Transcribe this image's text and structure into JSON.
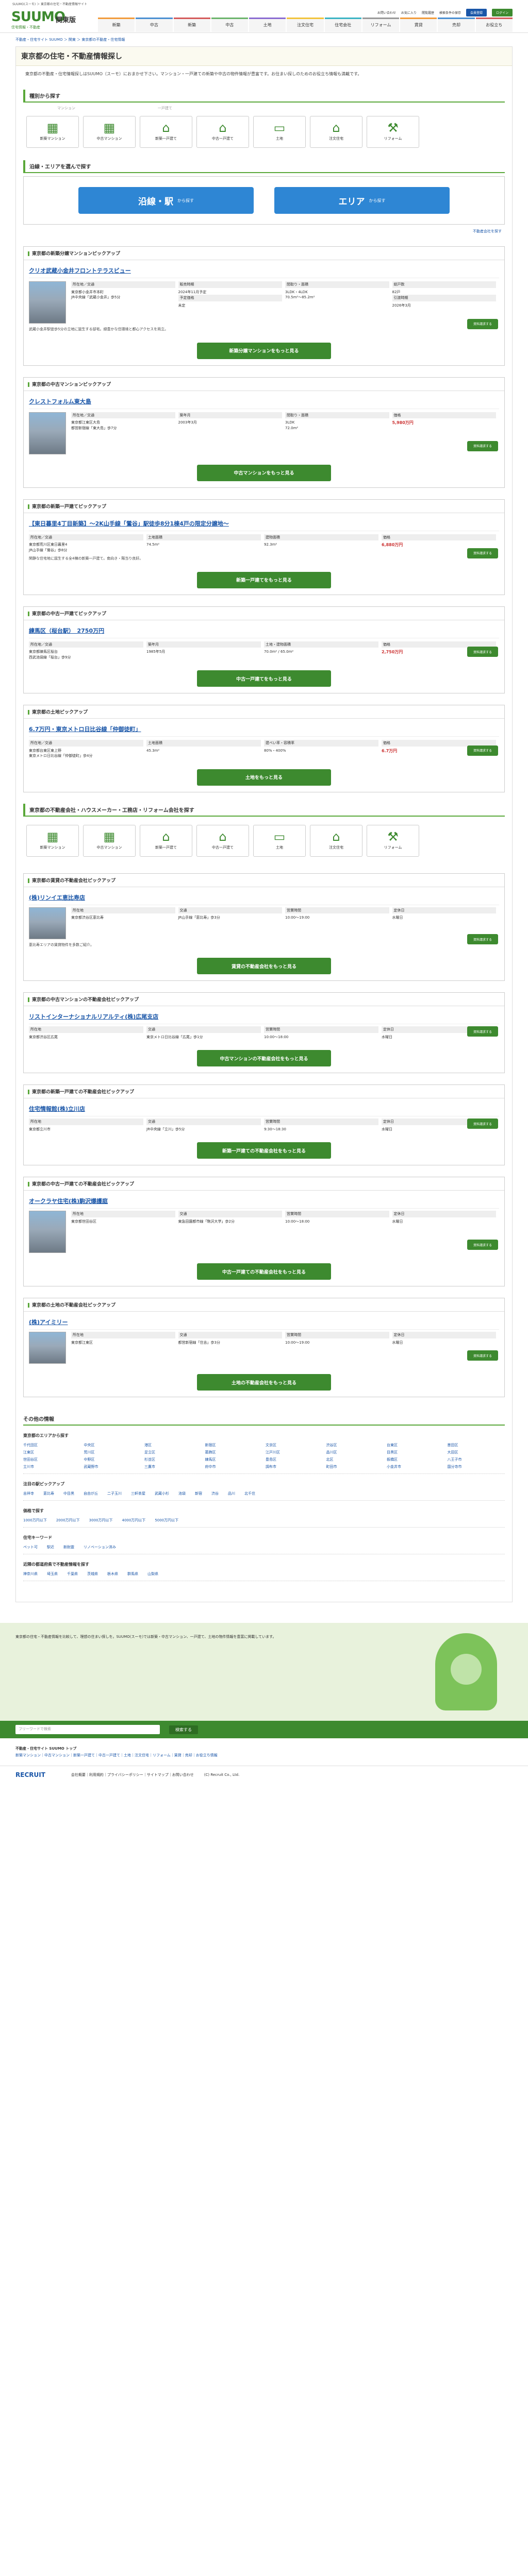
{
  "top": {
    "strip": "SUUMO(スーモ) ＞ 東京都の住宅・不動産情報サイト"
  },
  "header": {
    "logo": "SUUMO",
    "logo_sub": "住宅情報・不動産",
    "region": "関東版",
    "util": [
      "お問い合わせ",
      "お気に入り",
      "閲覧履歴",
      "検索条件の保存",
      "ログイン"
    ],
    "register": "会員登録",
    "login": "ログイン",
    "minilist": [
      "新築マンション",
      "中古マンション",
      "新築一戸建て",
      "中古一戸建て",
      "土地",
      "賃貸",
      "リフォーム"
    ],
    "cats": [
      "新築",
      "中古",
      "新築",
      "中古",
      "土地",
      "注文住宅",
      "住宅会社",
      "リフォーム",
      "賃貸",
      "売却",
      "お役立ち"
    ]
  },
  "breadcrumb": "不動産・住宅サイト SUUMO ＞ 関東 ＞ 東京都の不動産・住宅情報",
  "title": "東京都の住宅・不動産情報探し",
  "intro": "東京都の不動産・住宅情報探しはSUUMO（スーモ）におまかせ下さい。マンション・一戸建ての新築や中古の物件情報が豊富です。お住まい探しのためのお役立ち情報も満載です。",
  "types_heading": "種別から探す",
  "types_sub_left": "マンション",
  "types_sub_right": "一戸建て",
  "types": [
    {
      "icon": "building",
      "label": "新築マンション"
    },
    {
      "icon": "building",
      "label": "中古マンション"
    },
    {
      "icon": "house",
      "label": "新築一戸建て"
    },
    {
      "icon": "house",
      "label": "中古一戸建て"
    },
    {
      "icon": "land",
      "label": "土地"
    },
    {
      "icon": "plan",
      "label": "注文住宅"
    },
    {
      "icon": "tools",
      "label": "リフォーム"
    }
  ],
  "area_heading": "沿線・エリアを選んで探す",
  "search_btns": [
    {
      "label": "沿線・駅",
      "sub": "から探す"
    },
    {
      "label": "エリア",
      "sub": "から探す"
    }
  ],
  "help_link": "不動産会社を探す",
  "pickups": [
    {
      "heading": "東京都の新築分譲マンションピックアップ",
      "title": "クリオ武蔵小金井フロントテラスビュー",
      "cols": [
        [
          "所在地／交通",
          "東京都小金井市本町",
          "JR中央線「武蔵小金井」歩5分"
        ],
        [
          "販売時期",
          "2024年11月予定",
          "予定価格",
          "未定"
        ],
        [
          "間取り・面積",
          "3LDK・4LDK",
          "70.5m²～85.2m²"
        ],
        [
          "総戸数",
          "82戸",
          "引渡時期",
          "2026年3月"
        ]
      ],
      "desc": "武蔵小金井駅徒歩5分の立地に誕生する邸宅。緑豊かな住環境と都心アクセスを両立。",
      "more": "新築分譲マンションをもっと見る",
      "img": "tall"
    },
    {
      "heading": "東京都の中古マンションピックアップ",
      "title": "クレストフォルム東大島",
      "cols": [
        [
          "所在地／交通",
          "東京都江東区大島",
          "都営新宿線「東大島」歩7分"
        ],
        [
          "築年月",
          "2003年3月"
        ],
        [
          "間取り・面積",
          "3LDK",
          "72.0m²"
        ],
        [
          "価格",
          "5,980万円"
        ]
      ],
      "desc": "",
      "more": "中古マンションをもっと見る",
      "img": "tall"
    },
    {
      "heading": "東京都の新築一戸建てピックアップ",
      "title": "【東日暮里4丁目新築】～2K山手線「鶯谷」駅徒歩8分1棟4戸の限定分譲地～",
      "cols": [
        [
          "所在地／交通",
          "東京都荒川区東日暮里4",
          "JR山手線「鶯谷」歩8分"
        ],
        [
          "土地面積",
          "74.5m²"
        ],
        [
          "建物面積",
          "92.3m²"
        ],
        [
          "価格",
          "6,880万円"
        ]
      ],
      "desc": "閑静な住宅地に誕生する全4棟の新築一戸建て。南向き・陽当り良好。",
      "more": "新築一戸建てをもっと見る",
      "img": "none"
    },
    {
      "heading": "東京都の中古一戸建てピックアップ",
      "title": "練馬区（桜台駅）　2750万円",
      "cols": [
        [
          "所在地／交通",
          "東京都練馬区桜台",
          "西武池袋線「桜台」歩9分"
        ],
        [
          "築年月",
          "1985年5月"
        ],
        [
          "土地・建物面積",
          "70.0m² / 65.0m²"
        ],
        [
          "価格",
          "2,750万円"
        ]
      ],
      "desc": "",
      "more": "中古一戸建てをもっと見る",
      "img": "none"
    },
    {
      "heading": "東京都の土地ピックアップ",
      "title": "6.7万円・東京メトロ日比谷線「仲御徒町」",
      "cols": [
        [
          "所在地／交通",
          "東京都台東区東上野",
          "東京メトロ日比谷線「仲御徒町」歩4分"
        ],
        [
          "土地面積",
          "45.3m²"
        ],
        [
          "建ぺい率・容積率",
          "80%・400%"
        ],
        [
          "価格",
          "6.7万円"
        ]
      ],
      "desc": "",
      "more": "土地をもっと見る",
      "img": "none"
    }
  ],
  "agent_heading": "東京都の不動産会社・ハウスメーカー・工務店・リフォーム会社を探す",
  "agent_types": [
    "新築マンション",
    "中古マンション",
    "新築一戸建て",
    "中古一戸建て",
    "土地",
    "注文住宅",
    "リフォーム"
  ],
  "agents": [
    {
      "heading": "東京都の賃貸の不動産会社ピックアップ",
      "title": "(株)リンイエ恵比寿店",
      "cols": [
        [
          "所在地",
          "東京都渋谷区恵比寿"
        ],
        [
          "交通",
          "JR山手線「恵比寿」歩3分"
        ],
        [
          "営業時間",
          "10:00～19:00"
        ],
        [
          "定休日",
          "水曜日"
        ]
      ],
      "desc": "恵比寿エリアの賃貸物件を多数ご紹介。",
      "more": "賃貸の不動産会社をもっと見る"
    },
    {
      "heading": "東京都の中古マンションの不動産会社ピックアップ",
      "title": "リストインターナショナルリアルティ(株)広尾支店",
      "cols": [
        [
          "所在地",
          "東京都渋谷区広尾"
        ],
        [
          "交通",
          "東京メトロ日比谷線「広尾」歩1分"
        ],
        [
          "営業時間",
          "10:00～18:00"
        ],
        [
          "定休日",
          "水曜日"
        ]
      ],
      "desc": "",
      "more": "中古マンションの不動産会社をもっと見る"
    },
    {
      "heading": "東京都の新築一戸建ての不動産会社ピックアップ",
      "title": "住宅情報館(株)立川店",
      "cols": [
        [
          "所在地",
          "東京都立川市"
        ],
        [
          "交通",
          "JR中央線「立川」歩5分"
        ],
        [
          "営業時間",
          "9:30～18:30"
        ],
        [
          "定休日",
          "水曜日"
        ]
      ],
      "desc": "",
      "more": "新築一戸建ての不動産会社をもっと見る"
    },
    {
      "heading": "東京都の中古一戸建ての不動産会社ピックアップ",
      "title": "オークラヤ住宅(株)駒沢爆護庭",
      "cols": [
        [
          "所在地",
          "東京都世田谷区"
        ],
        [
          "交通",
          "東急田園都市線「駒沢大学」歩2分"
        ],
        [
          "営業時間",
          "10:00～18:00"
        ],
        [
          "定休日",
          "水曜日"
        ]
      ],
      "desc": "",
      "more": "中古一戸建ての不動産会社をもっと見る"
    },
    {
      "heading": "東京都の土地の不動産会社ピックアップ",
      "title": "(株)アイミリー",
      "cols": [
        [
          "所在地",
          "東京都江東区"
        ],
        [
          "交通",
          "都営新宿線「住吉」歩3分"
        ],
        [
          "営業時間",
          "10:00～19:00"
        ],
        [
          "定休日",
          "水曜日"
        ]
      ],
      "desc": "",
      "more": "土地の不動産会社をもっと見る"
    }
  ],
  "others": {
    "heading": "その他の情報",
    "areas_title": "東京都のエリアから探す",
    "areas": [
      "千代田区",
      "中央区",
      "港区",
      "新宿区",
      "文京区",
      "渋谷区",
      "台東区",
      "墨田区",
      "江東区",
      "荒川区",
      "足立区",
      "葛飾区",
      "江戸川区",
      "品川区",
      "目黒区",
      "大田区",
      "世田谷区",
      "中野区",
      "杉並区",
      "練馬区",
      "豊島区",
      "北区",
      "板橋区",
      "八王子市",
      "立川市",
      "武蔵野市",
      "三鷹市",
      "府中市",
      "調布市",
      "町田市",
      "小金井市",
      "国分寺市"
    ],
    "stations_title": "注目の駅ピックアップ",
    "stations": [
      "吉祥寺",
      "恵比寿",
      "中目黒",
      "自由が丘",
      "二子玉川",
      "三軒茶屋",
      "武蔵小杉",
      "池袋",
      "新宿",
      "渋谷",
      "品川",
      "北千住"
    ],
    "price_title": "価格で探す",
    "prices": [
      "1000万円以下",
      "2000万円以下",
      "3000万円以下",
      "4000万円以下",
      "5000万円以下"
    ],
    "kw_title": "住宅キーワード",
    "keywords": [
      "ペット可",
      "駅近",
      "新耐震",
      "リノベーション済み"
    ],
    "bottom_title": "近隣の都道府県で不動産情報を探す",
    "bottom": [
      "神奈川県",
      "埼玉県",
      "千葉県",
      "茨城県",
      "栃木県",
      "群馬県",
      "山梨県"
    ]
  },
  "footer": {
    "text": "東京都の住宅・不動産情報を比較して、理想の住まい探しを。SUUMO(スーモ)では新築・中古マンション、一戸建て、土地の物件情報を豊富に掲載しています。",
    "search_placeholder": "フリーワードで検索",
    "search_btn": "検索する",
    "links_title": "不動産・住宅サイト SUUMO トップ",
    "links": "新築マンション｜中古マンション｜新築一戸建て｜中古一戸建て｜土地｜注文住宅｜リフォーム｜賃貸｜売却｜お役立ち情報",
    "sub_links": "会社概要｜利用規約｜プライバシーポリシー｜サイトマップ｜お問い合わせ",
    "recruit": "RECRUIT",
    "copyright": "(C) Recruit Co., Ltd."
  }
}
